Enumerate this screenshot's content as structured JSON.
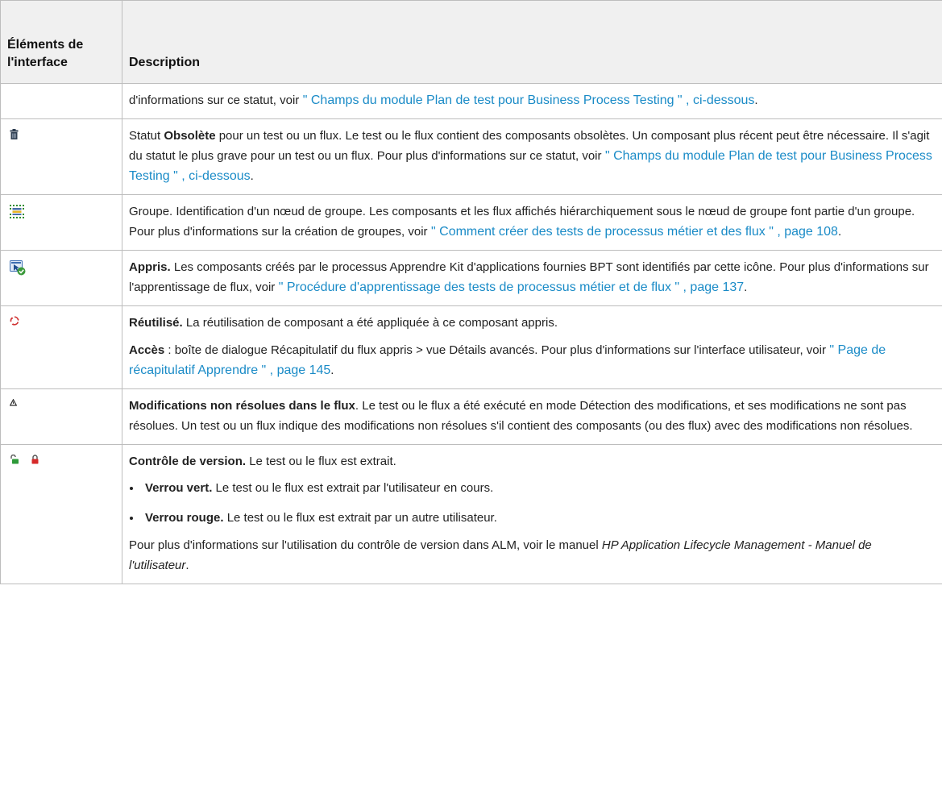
{
  "table": {
    "headers": [
      "Éléments de l'interface",
      "Description"
    ],
    "rows": [
      {
        "p1": {
          "a": "d'informations sur ce statut, voir",
          "link": " \" Champs du module Plan de test pour Business Process Testing \" , ci-dessous",
          "b": "."
        }
      },
      {
        "icon": "trash-icon",
        "p1": {
          "a": "Statut ",
          "bold": "Obsolète",
          "b": " pour un test ou un flux. Le test ou le flux contient des composants obsolètes. Un composant plus récent peut être nécessaire. Il s'agit du statut le plus grave pour un test ou un flux. Pour plus d'informations sur ce statut, voir",
          "link": " \" Champs du module Plan de test pour Business Process Testing \" , ci-dessous",
          "c": "."
        }
      },
      {
        "icon": "group-node-icon",
        "p1": {
          "a": "Groupe. Identification d'un nœud de groupe. Les composants et les flux affichés hiérarchiquement sous le nœud de groupe font partie d'un groupe. Pour plus d'informations sur la création de groupes, voir",
          "link": " \" Comment créer des tests de processus métier et des flux \" , page 108",
          "b": "."
        }
      },
      {
        "icon": "learned-component-icon",
        "p1": {
          "bold": "Appris.",
          "a": " Les composants créés par le processus Apprendre Kit d'applications fournies BPT sont identifiés par cette icône. Pour plus d'informations sur l'apprentissage de flux, voir",
          "link": " \" Procédure d'apprentissage des tests de processus métier et de flux \" , page 137",
          "b": "."
        }
      },
      {
        "icon": "reuse-arrows-icon",
        "p1": {
          "bold": "Réutilisé.",
          "a": " La réutilisation de composant a été appliquée à ce composant appris."
        },
        "p2": {
          "bold": "Accès",
          "a": " : boîte de dialogue Récapitulatif du flux appris > vue Détails avancés. Pour plus d'informations sur l'interface utilisateur, voir",
          "link": " \" Page de récapitulatif Apprendre \" , page 145",
          "b": "."
        }
      },
      {
        "icon": "unresolved-changes-icon",
        "p1": {
          "bold": "Modifications non résolues dans le flux",
          "a": ". Le test ou le flux a été exécuté en mode Détection des modifications, et ses modifications ne sont pas résolues. Un test ou un flux indique des modifications non résolues s'il contient des composants (ou des flux) avec des modifications non résolues."
        }
      },
      {
        "icons": [
          "green-lock-icon",
          "red-lock-icon"
        ],
        "p1": {
          "bold": "Contrôle de version.",
          "a": " Le test ou le flux est extrait."
        },
        "bullets": [
          {
            "bold": "Verrou vert.",
            "text": " Le test ou le flux est extrait par l'utilisateur en cours."
          },
          {
            "bold": "Verrou rouge.",
            "text": " Le test ou le flux est extrait par un autre utilisateur."
          }
        ],
        "p2": {
          "a": "Pour plus d'informations sur l'utilisation du contrôle de version dans ALM, voir le manuel ",
          "ital": "HP Application Lifecycle Management - Manuel de l'utilisateur",
          "b": "."
        }
      }
    ]
  },
  "colors": {
    "link": "#1a8bc7",
    "header_bg": "#f0f0f0",
    "border": "#bdbdbd"
  }
}
